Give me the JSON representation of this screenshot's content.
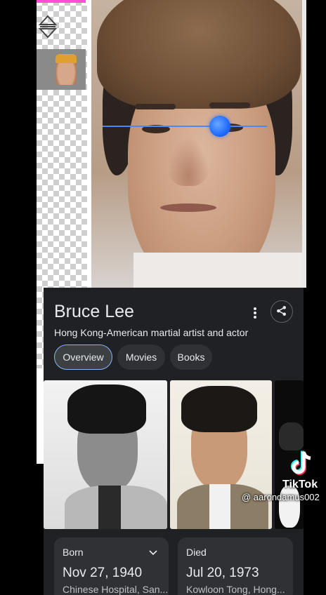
{
  "knowledge_panel": {
    "title": "Bruce Lee",
    "subtitle": "Hong Kong-American martial artist and actor",
    "tabs": [
      {
        "label": "Overview",
        "active": true
      },
      {
        "label": "Movies",
        "active": false
      },
      {
        "label": "Books",
        "active": false
      }
    ],
    "facts": [
      {
        "label": "Born",
        "date": "Nov 27, 1940",
        "place": "Chinese Hospital, San..."
      },
      {
        "label": "Died",
        "date": "Jul 20, 1973",
        "place": "Kowloon Tong, Hong..."
      }
    ]
  },
  "overlay": {
    "brand": "TikTok",
    "username": "@ aarondamus002"
  },
  "icons": {
    "reorder": "reorder-icon",
    "more": "more-vert-icon",
    "share": "share-icon",
    "chevron": "chevron-down-icon",
    "tiktok": "tiktok-logo-icon"
  },
  "colors": {
    "panel_bg": "#202124",
    "chip_bg": "#303134",
    "active_chip_border": "#8ab4f8",
    "handle": "#1f6bff",
    "accent_pink": "#ff4fd8"
  }
}
